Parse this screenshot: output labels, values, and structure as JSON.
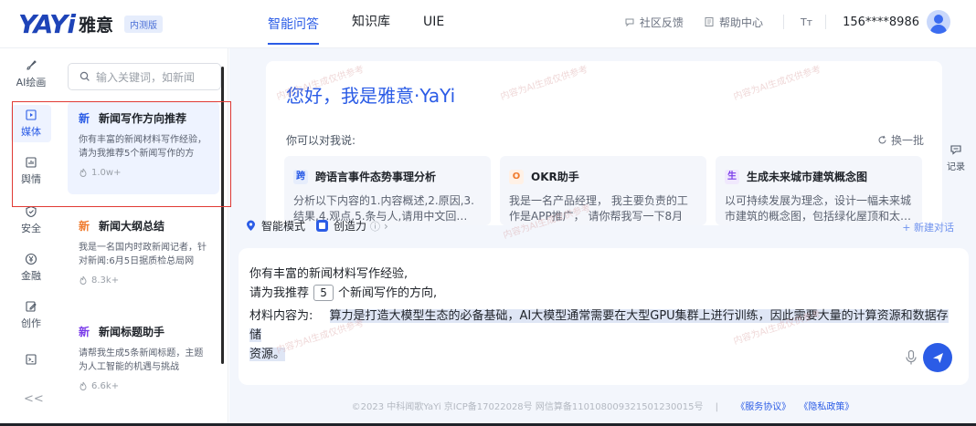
{
  "header": {
    "logo_text": "YAYi",
    "logo_cn": "雅意",
    "badge": "内测版",
    "tabs": [
      {
        "label": "智能问答",
        "active": true
      },
      {
        "label": "知识库",
        "active": false
      },
      {
        "label": "UIE",
        "active": false
      }
    ],
    "feedback": "社区反馈",
    "help": "帮助中心",
    "font_toggle": "Tт",
    "phone": "156****8986"
  },
  "rail": {
    "items": [
      {
        "label": "AI绘画",
        "icon": "brush-icon"
      },
      {
        "label": "媒体",
        "icon": "media-icon",
        "active": true
      },
      {
        "label": "舆情",
        "icon": "chart-icon"
      },
      {
        "label": "安全",
        "icon": "shield-icon"
      },
      {
        "label": "金融",
        "icon": "yen-icon"
      },
      {
        "label": "创作",
        "icon": "edit-icon"
      },
      {
        "label": "",
        "icon": "terminal-icon"
      }
    ],
    "collapse": "<<"
  },
  "panel": {
    "search_placeholder": "输入关键词，如新闻",
    "cards": [
      {
        "tag": "新",
        "title": "新闻写作方向推荐",
        "desc": "你有丰富的新闻材料写作经验，请为我推荐5个新闻写作的方向…",
        "count": "1.0w+"
      },
      {
        "tag": "新",
        "title": "新闻大纲总结",
        "desc": "我是一名国内时政新闻记者，针对新闻:6月5日据质检总局网站…",
        "count": "8.3k+"
      },
      {
        "tag": "新",
        "title": "新闻标题助手",
        "desc": "请帮我生成5条新闻标题，主题为人工智能的机遇与挑战",
        "count": "6.6k+"
      }
    ]
  },
  "welcome": {
    "title": "您好，我是雅意·YaYi",
    "subtitle": "你可以对我说:",
    "refresh": "换一批",
    "suggestions": [
      {
        "icon": "跨",
        "title": "跨语言事件态势事理分析",
        "desc": "分析以下内容的1.内容概述,2.原因,3.结果,4.观点,5.条与人,请用中文回…",
        "color": "#2b5ce6",
        "bg": "#e6edfc"
      },
      {
        "icon": "O",
        "title": "OKR助手",
        "desc": "我是一名产品经理， 我主要负责的工作是APP推广， 请你帮我写一下8月的…",
        "color": "#f07b2e",
        "bg": "#fff1e6"
      },
      {
        "icon": "生",
        "title": "生成未来城市建筑概念图",
        "desc": "以可持续发展为理念，设计一幅未来城市建筑的概念图，包括绿化屋顶和太…",
        "color": "#7a3bea",
        "bg": "#f0e8fd"
      }
    ],
    "record": "记录",
    "new_chat": "+ 新建对话"
  },
  "modes": {
    "smart": "智能模式",
    "creativity": "创造力"
  },
  "editor": {
    "line1": "你有丰富的新闻材料写作经验,",
    "line2_pre": "请为我推荐",
    "line2_num": "5",
    "line2_post": "个新闻写作的方向,",
    "line3_label": "材料内容为:",
    "line3_text": "算力是打造大模型生态的必备基础，AI大模型通常需要在大型GPU集群上进行训练，因此需要大量的计算资源和数据存储",
    "line4": "资源。"
  },
  "footer": {
    "copyright": "©2023 中科闻歌YaYi  京ICP备17022028号  网信算备110108009321501230015号",
    "sep": "|",
    "terms": "《服务协议》",
    "privacy": "《隐私政策》"
  },
  "watermark": "内容为AI生成仅供参考"
}
